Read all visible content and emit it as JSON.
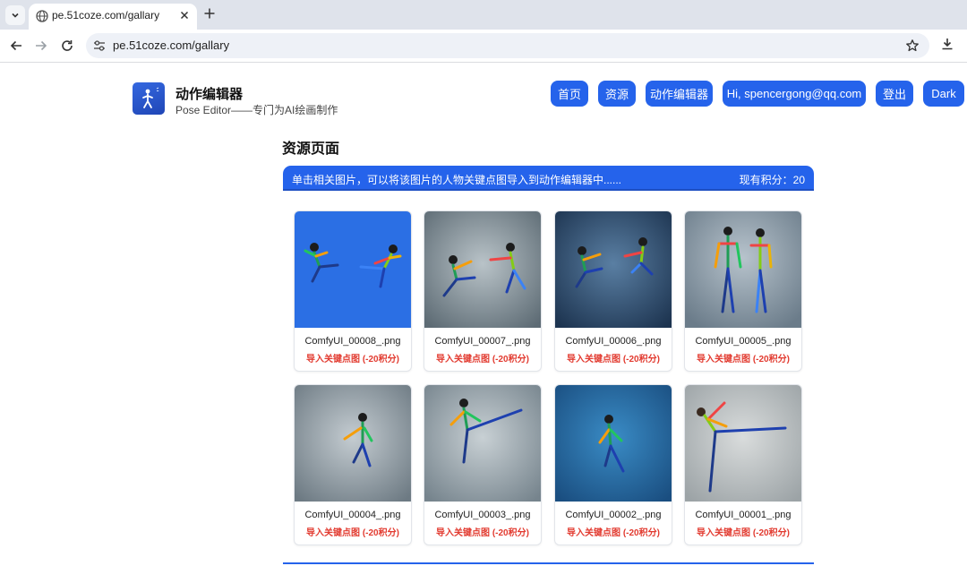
{
  "browser": {
    "tab_title": "pe.51coze.com/gallary",
    "url": "pe.51coze.com/gallary"
  },
  "brand": {
    "title": "动作编辑器",
    "subtitle": "Pose Editor——专门为AI绘画制作"
  },
  "nav": {
    "home": "首页",
    "resources": "资源",
    "editor": "动作编辑器",
    "user": "Hi, spencergong@qq.com",
    "logout": "登出",
    "theme": "Dark"
  },
  "page": {
    "title": "资源页面",
    "info": "单击相关图片，可以将该图片的人物关键点图导入到动作编辑器中......",
    "points": "现有积分：20"
  },
  "gallery": [
    {
      "name": "ComfyUI_00008_.png",
      "action": "导入关键点图 (-20积分)"
    },
    {
      "name": "ComfyUI_00007_.png",
      "action": "导入关键点图 (-20积分)"
    },
    {
      "name": "ComfyUI_00006_.png",
      "action": "导入关键点图 (-20积分)"
    },
    {
      "name": "ComfyUI_00005_.png",
      "action": "导入关键点图 (-20积分)"
    },
    {
      "name": "ComfyUI_00004_.png",
      "action": "导入关键点图 (-20积分)"
    },
    {
      "name": "ComfyUI_00003_.png",
      "action": "导入关键点图 (-20积分)"
    },
    {
      "name": "ComfyUI_00002_.png",
      "action": "导入关键点图 (-20积分)"
    },
    {
      "name": "ComfyUI_00001_.png",
      "action": "导入关键点图 (-20积分)"
    }
  ],
  "colors": {
    "accent": "#2563eb",
    "warning_text": "#e23a2f"
  },
  "icons": [
    "chevron-down-icon",
    "globe-icon",
    "close-icon",
    "plus-icon",
    "back-icon",
    "forward-icon",
    "reload-icon",
    "site-settings-icon",
    "star-icon",
    "download-icon",
    "stick-figure-icon"
  ]
}
